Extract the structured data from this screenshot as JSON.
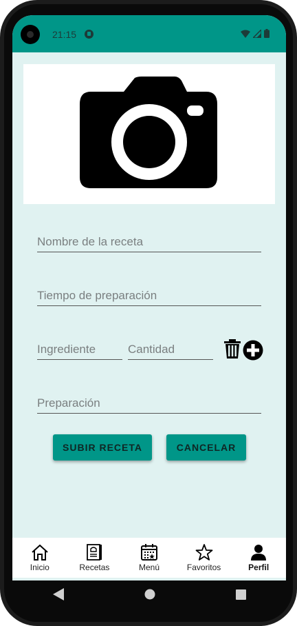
{
  "status": {
    "time": "21:15"
  },
  "form": {
    "recipe_name_placeholder": "Nombre de la receta",
    "prep_time_placeholder": "Tiempo de preparación",
    "ingredient_placeholder": "Ingrediente",
    "quantity_placeholder": "Cantidad",
    "preparation_placeholder": "Preparación"
  },
  "buttons": {
    "submit_label": "SUBIR RECETA",
    "cancel_label": "CANCELAR"
  },
  "bottom_nav": {
    "items": [
      {
        "label": "Inicio",
        "icon": "home-icon"
      },
      {
        "label": "Recetas",
        "icon": "recipe-book-icon"
      },
      {
        "label": "Menú",
        "icon": "calendar-icon"
      },
      {
        "label": "Favoritos",
        "icon": "star-icon"
      },
      {
        "label": "Perfil",
        "icon": "person-icon",
        "active": true
      }
    ]
  },
  "colors": {
    "primary": "#009688",
    "background": "#e0f2f1"
  }
}
